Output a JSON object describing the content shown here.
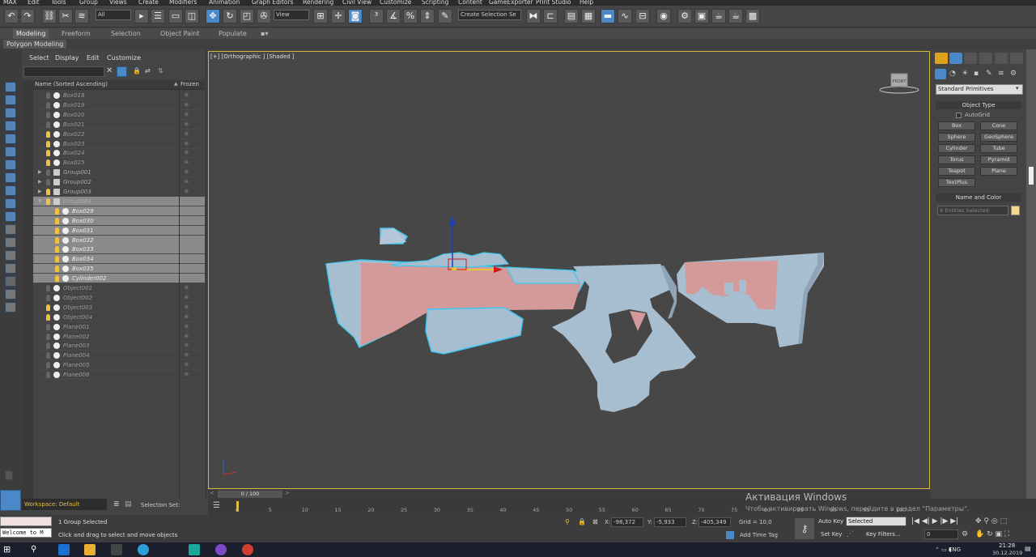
{
  "menu": [
    "MAX",
    "Edit",
    "Tools",
    "Group",
    "Views",
    "Create",
    "Modifiers",
    "Animation",
    "Graph Editors",
    "Rendering",
    "Civil View",
    "Customize",
    "Scripting",
    "Content",
    "GameExporter",
    "Print Studio",
    "Help"
  ],
  "toolbar": {
    "filter_value": "All",
    "view_value": "View",
    "selection_set_placeholder": "Create Selection Se"
  },
  "ribbon": {
    "tabs": [
      "Modeling",
      "Freeform",
      "Selection",
      "Object Paint",
      "Populate"
    ],
    "sub_label": "Polygon Modeling"
  },
  "explorer": {
    "menu": [
      "Select",
      "Display",
      "Edit",
      "Customize"
    ],
    "column_name": "Name (Sorted Ascending)",
    "column_frozen": "Frozen",
    "frozen_glyph": "✳",
    "rows": [
      {
        "name": "Box018",
        "bulb": false,
        "selected": false,
        "kind": "obj"
      },
      {
        "name": "Box019",
        "bulb": false,
        "selected": false,
        "kind": "obj"
      },
      {
        "name": "Box020",
        "bulb": false,
        "selected": false,
        "kind": "obj"
      },
      {
        "name": "Box021",
        "bulb": false,
        "selected": false,
        "kind": "obj"
      },
      {
        "name": "Box022",
        "bulb": true,
        "selected": false,
        "kind": "obj"
      },
      {
        "name": "Box023",
        "bulb": true,
        "selected": false,
        "kind": "obj"
      },
      {
        "name": "Box024",
        "bulb": true,
        "selected": false,
        "kind": "obj"
      },
      {
        "name": "Box025",
        "bulb": true,
        "selected": false,
        "kind": "obj"
      },
      {
        "name": "Group001",
        "bulb": false,
        "selected": false,
        "kind": "group"
      },
      {
        "name": "Group002",
        "bulb": false,
        "selected": false,
        "kind": "group"
      },
      {
        "name": "Group003",
        "bulb": true,
        "selected": false,
        "kind": "group"
      },
      {
        "name": "Group004",
        "bulb": true,
        "selected": true,
        "kind": "group-open"
      },
      {
        "name": "Box029",
        "bulb": true,
        "selected": true,
        "kind": "child"
      },
      {
        "name": "Box030",
        "bulb": true,
        "selected": true,
        "kind": "child"
      },
      {
        "name": "Box031",
        "bulb": true,
        "selected": true,
        "kind": "child"
      },
      {
        "name": "Box032",
        "bulb": true,
        "selected": true,
        "kind": "child"
      },
      {
        "name": "Box033",
        "bulb": true,
        "selected": true,
        "kind": "child"
      },
      {
        "name": "Box034",
        "bulb": true,
        "selected": true,
        "kind": "child"
      },
      {
        "name": "Box035",
        "bulb": true,
        "selected": true,
        "kind": "child"
      },
      {
        "name": "Cylinder002",
        "bulb": true,
        "selected": true,
        "kind": "child"
      },
      {
        "name": "Object001",
        "bulb": false,
        "selected": false,
        "kind": "obj"
      },
      {
        "name": "Object002",
        "bulb": false,
        "selected": false,
        "kind": "obj"
      },
      {
        "name": "Object003",
        "bulb": true,
        "selected": false,
        "kind": "obj"
      },
      {
        "name": "Object004",
        "bulb": true,
        "selected": false,
        "kind": "obj"
      },
      {
        "name": "Plane001",
        "bulb": false,
        "selected": false,
        "kind": "obj"
      },
      {
        "name": "Plane002",
        "bulb": false,
        "selected": false,
        "kind": "obj"
      },
      {
        "name": "Plane003",
        "bulb": false,
        "selected": false,
        "kind": "obj"
      },
      {
        "name": "Plane004",
        "bulb": false,
        "selected": false,
        "kind": "obj"
      },
      {
        "name": "Plane005",
        "bulb": false,
        "selected": false,
        "kind": "obj"
      },
      {
        "name": "Plane006",
        "bulb": false,
        "selected": false,
        "kind": "obj"
      }
    ],
    "workspace": "Workspace: Default",
    "selection_set": "Selection Set:"
  },
  "viewport": {
    "label": "[+] [Orthographic ] [Shaded ]",
    "viewcube_label": "FRONT"
  },
  "command_panel": {
    "dropdown": "Standard Primitives",
    "object_type_header": "Object Type",
    "autogrid": "AutoGrid",
    "buttons": [
      "Box",
      "Cone",
      "Sphere",
      "GeoSphere",
      "Cylinder",
      "Tube",
      "Torus",
      "Pyramid",
      "Teapot",
      "Plane",
      "TextPlus"
    ],
    "name_color_header": "Name and Color",
    "name_value": "9 Entities Selected"
  },
  "timeline": {
    "range": "0 / 100",
    "ticks": [
      "0",
      "5",
      "10",
      "15",
      "20",
      "25",
      "30",
      "35",
      "40",
      "45",
      "50",
      "55",
      "60",
      "65",
      "70",
      "75",
      "80",
      "85",
      "90",
      "95",
      "100"
    ]
  },
  "status": {
    "maxscript": "Welcome to M",
    "selection_info": "1 Group Selected",
    "prompt": "Click and drag to select and move objects",
    "x_label": "X:",
    "x_value": "-98,372",
    "y_label": "Y:",
    "y_value": "-5,933",
    "z_label": "Z:",
    "z_value": "-405,349",
    "grid": "Grid = 10,0",
    "add_time_tag": "Add Time Tag",
    "auto_key": "Auto Key",
    "set_key": "Set Key",
    "selected": "Selected",
    "key_filters": "Key Filters...",
    "frame": "0"
  },
  "activation": {
    "title": "Активация Windows",
    "sub": "Чтобы активировать Windows, перейдите в раздел \"Параметры\"."
  },
  "taskbar": {
    "lang": "ENG",
    "time": "21:28",
    "date": "30.12.2019"
  },
  "colors": {
    "viewport_border": "#d7b43a",
    "selection_outline": "#3ec8f0",
    "mesh_blue": "#a7bdd0",
    "mesh_pink": "#d49a9a",
    "accent": "#4a88c7"
  }
}
